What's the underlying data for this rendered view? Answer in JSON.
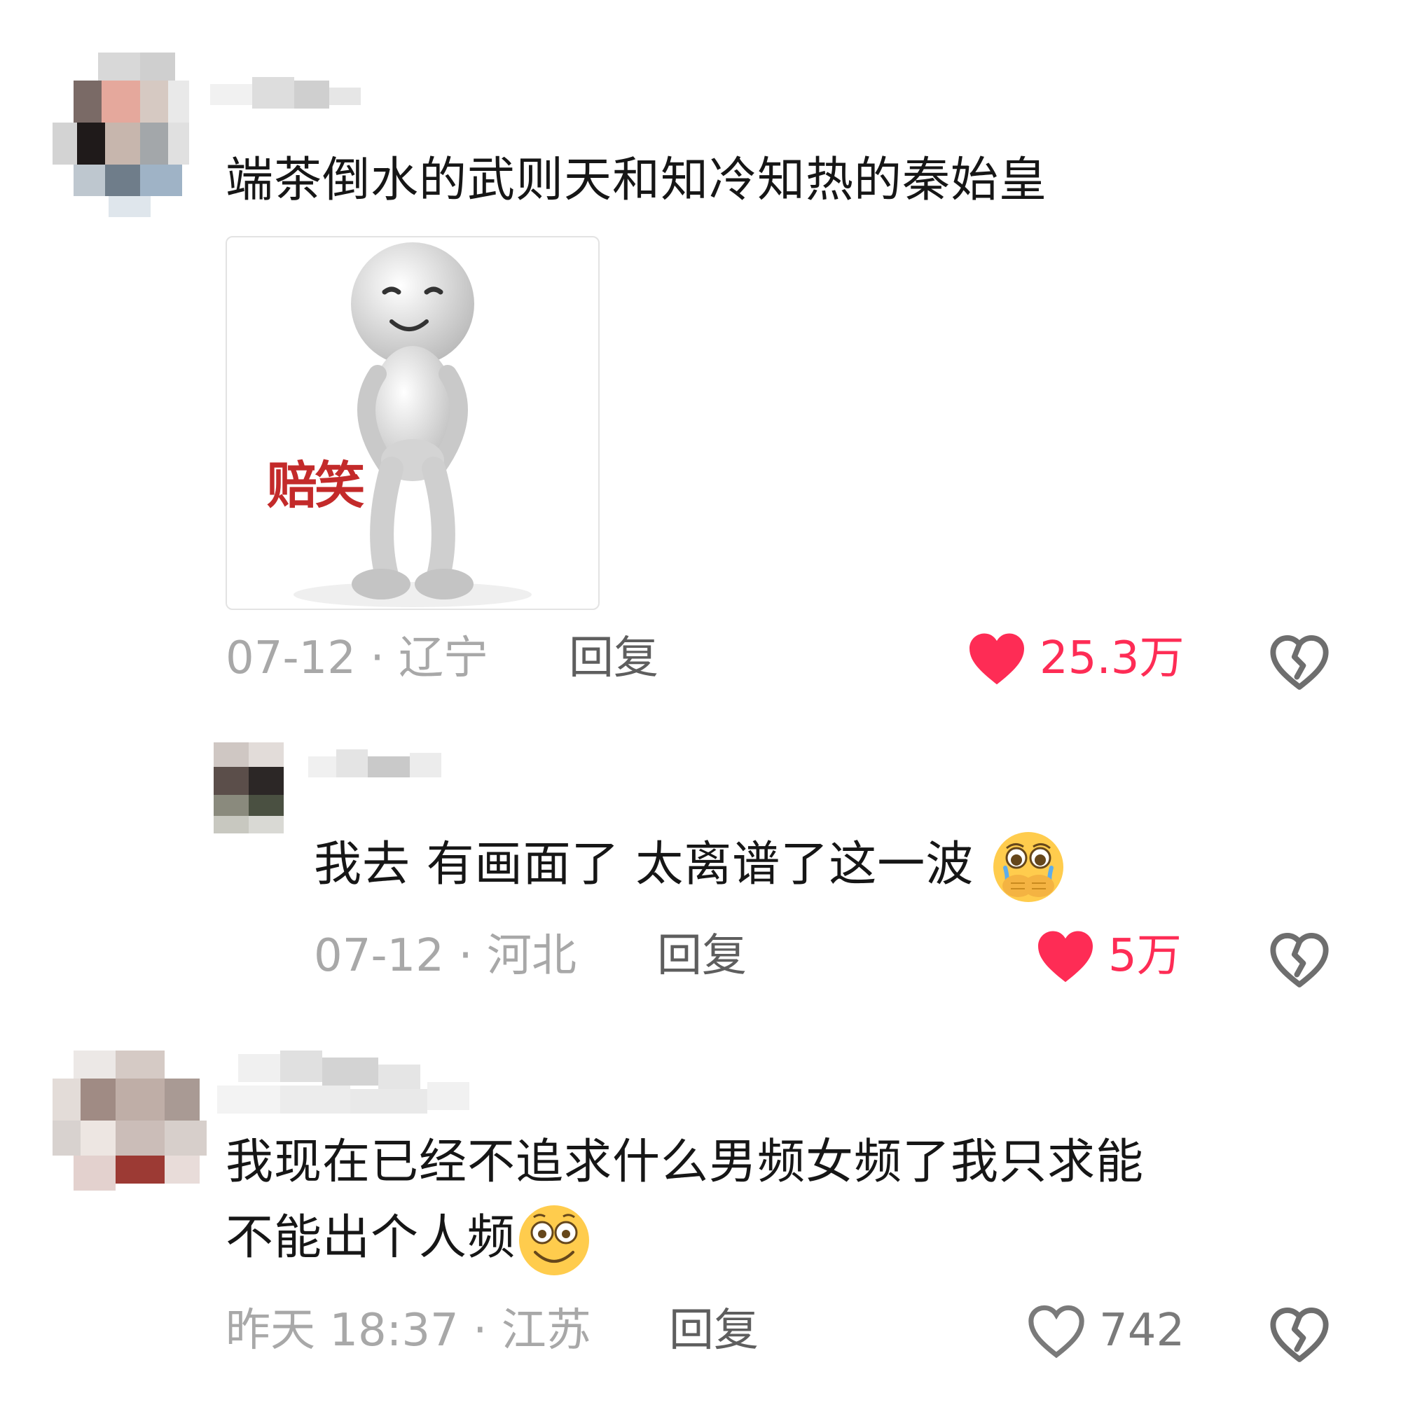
{
  "comments": [
    {
      "text": "端茶倒水的武则天和知冷知热的秦始皇",
      "sticker_label": "赔笑",
      "meta": "07-12 · 辽宁",
      "reply": "回复",
      "likes": "25.3万",
      "liked": true,
      "reply_item": {
        "text": "我去 有画面了 太离谱了这一波",
        "emoji": "crying-hands-over-mouth-emoji",
        "meta": "07-12 · 河北",
        "reply": "回复",
        "likes": "5万",
        "liked": true
      }
    },
    {
      "text_line1": "我现在已经不追求什么男频女频了我只求能",
      "text_line2": "不能出个人频",
      "emoji": "grinning-wide-eyes-emoji",
      "meta": "昨天 18:37 · 江苏",
      "reply": "回复",
      "likes": "742",
      "liked": false
    }
  ],
  "colors": {
    "like_red": "#fe2c55",
    "meta_gray": "#a8a8a8",
    "reply_gray": "#5e5e5e",
    "text": "#161616"
  },
  "icons": {
    "like": "heart-icon",
    "dislike": "broken-heart-icon"
  }
}
